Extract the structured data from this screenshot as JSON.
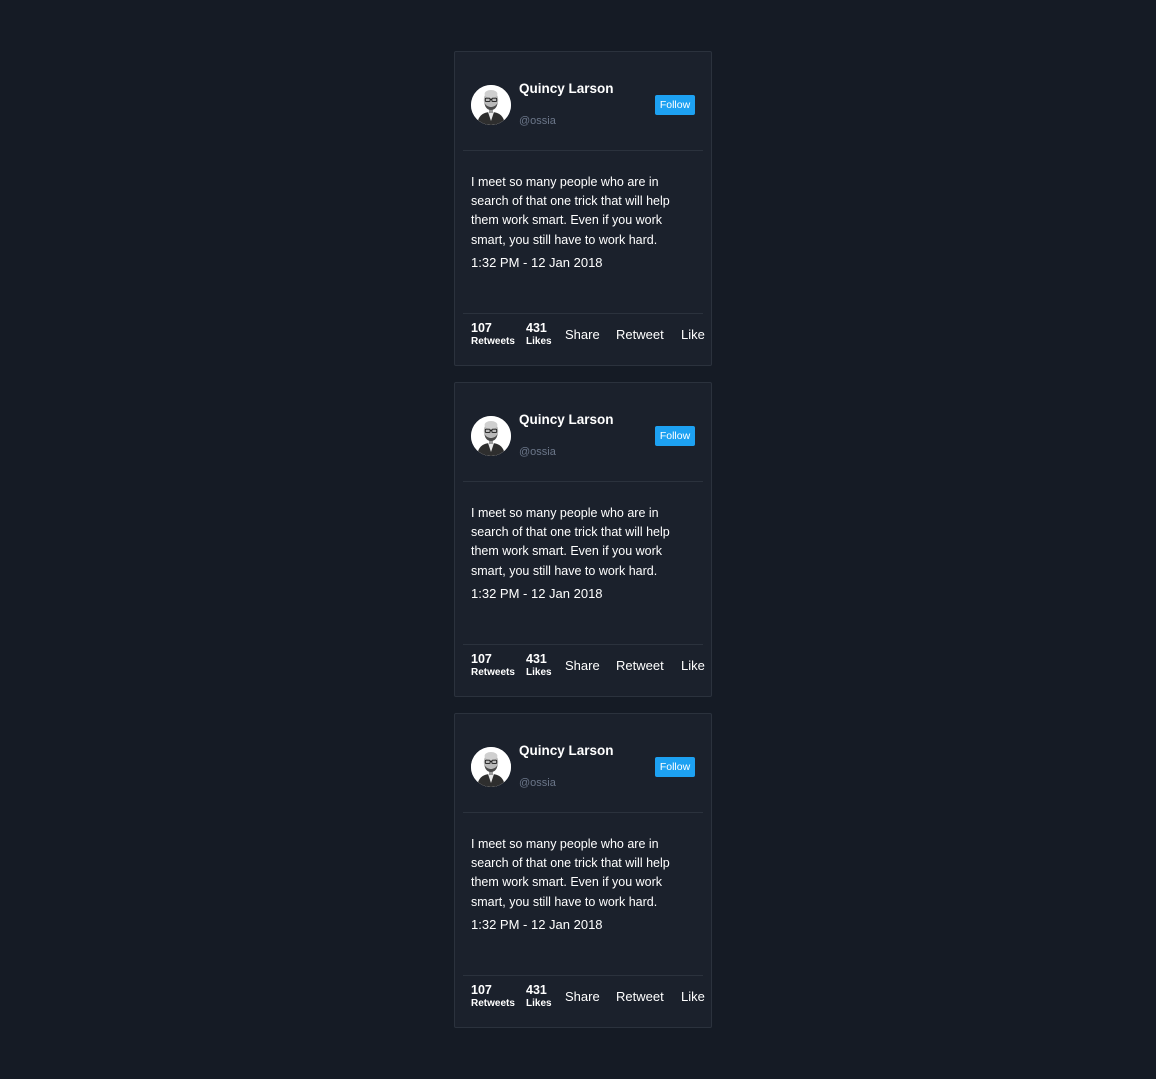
{
  "cards": [
    {
      "name": "Quincy Larson",
      "handle": "@ossia",
      "follow_label": "Follow",
      "text": "I meet so many people who are in search of that one trick that will help them work smart. Even if you work smart, you still have to work hard.",
      "time": "1:32 PM - 12 Jan 2018",
      "retweets_count": "107",
      "retweets_label": "Retweets",
      "likes_count": "431",
      "likes_label": "Likes",
      "share_label": "Share",
      "retweet_label": "Retweet",
      "like_label": "Like"
    },
    {
      "name": "Quincy Larson",
      "handle": "@ossia",
      "follow_label": "Follow",
      "text": "I meet so many people who are in search of that one trick that will help them work smart. Even if you work smart, you still have to work hard.",
      "time": "1:32 PM - 12 Jan 2018",
      "retweets_count": "107",
      "retweets_label": "Retweets",
      "likes_count": "431",
      "likes_label": "Likes",
      "share_label": "Share",
      "retweet_label": "Retweet",
      "like_label": "Like"
    },
    {
      "name": "Quincy Larson",
      "handle": "@ossia",
      "follow_label": "Follow",
      "text": "I meet so many people who are in search of that one trick that will help them work smart. Even if you work smart, you still have to work hard.",
      "time": "1:32 PM - 12 Jan 2018",
      "retweets_count": "107",
      "retweets_label": "Retweets",
      "likes_count": "431",
      "likes_label": "Likes",
      "share_label": "Share",
      "retweet_label": "Retweet",
      "like_label": "Like"
    }
  ],
  "colors": {
    "page_background": "#151b25",
    "card_background": "#1b212c",
    "card_border": "#2b323d",
    "follow_button": "#1da1f2",
    "handle_text": "#6b7689",
    "primary_text": "#ffffff"
  }
}
